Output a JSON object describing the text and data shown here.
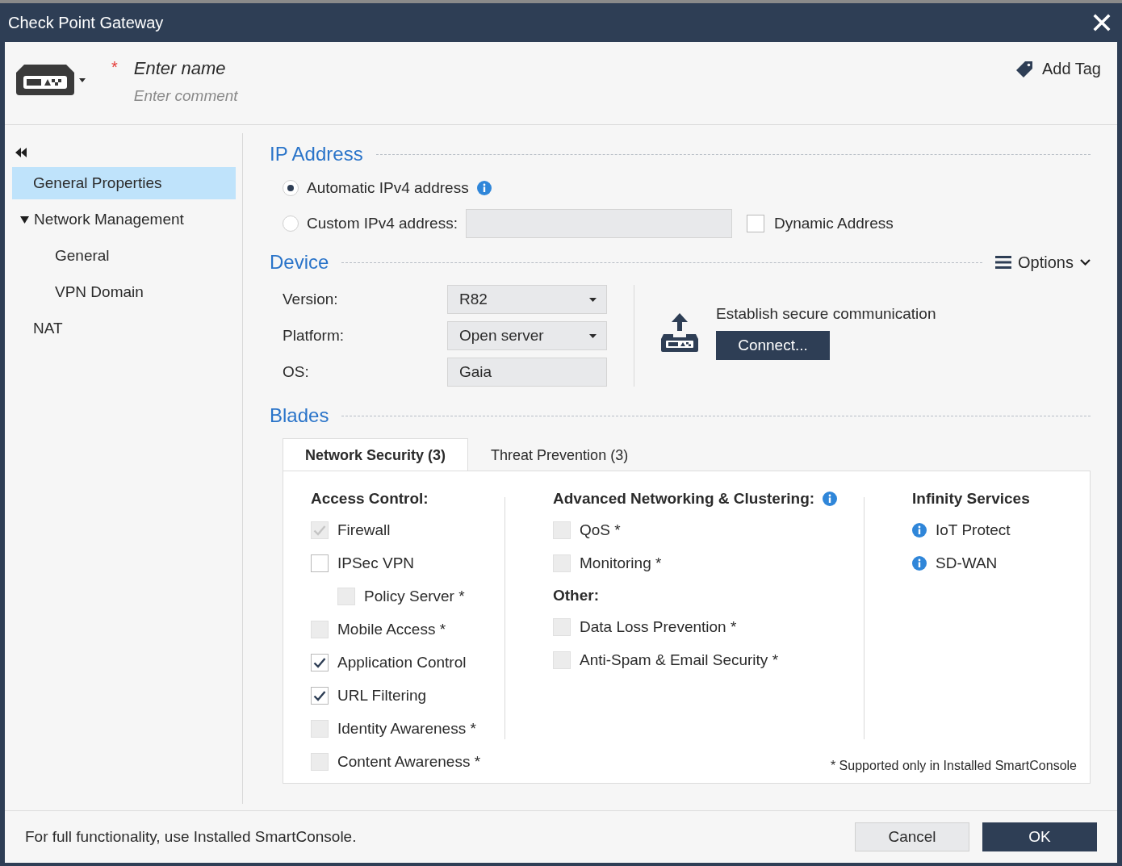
{
  "window": {
    "title": "Check Point Gateway"
  },
  "header": {
    "required_mark": "*",
    "name_placeholder": "Enter name",
    "comment_placeholder": "Enter comment",
    "add_tag": "Add Tag"
  },
  "sidebar": {
    "items": [
      {
        "label": "General Properties",
        "selected": true
      },
      {
        "label": "Network Management",
        "selected": false,
        "expanded": true,
        "children": [
          {
            "label": "General",
            "selected": false
          },
          {
            "label": "VPN Domain",
            "selected": false
          }
        ]
      },
      {
        "label": "NAT",
        "selected": false
      }
    ]
  },
  "ip_address": {
    "title": "IP Address",
    "options": [
      {
        "label": "Automatic IPv4 address",
        "selected": true,
        "info": true
      },
      {
        "label": "Custom IPv4 address:",
        "selected": false,
        "info": false
      }
    ],
    "dynamic_address": {
      "label": "Dynamic Address",
      "checked": false
    }
  },
  "device": {
    "title": "Device",
    "options_label": "Options",
    "fields": [
      {
        "label": "Version:",
        "value": "R82",
        "kind": "dropdown"
      },
      {
        "label": "Platform:",
        "value": "Open server",
        "kind": "dropdown"
      },
      {
        "label": "OS:",
        "value": "Gaia",
        "kind": "readonly"
      }
    ],
    "connect_text": "Establish secure communication",
    "connect_button": "Connect..."
  },
  "blades": {
    "title": "Blades",
    "tabs": [
      {
        "label": "Network Security (3)",
        "selected": true
      },
      {
        "label": "Threat Prevention (3)",
        "selected": false
      }
    ],
    "columns": [
      {
        "groups": [
          {
            "title": "Access Control:",
            "info": false,
            "items": [
              {
                "kind": "checkbox",
                "label": "Firewall",
                "checked": true,
                "disabled": true
              },
              {
                "kind": "checkbox",
                "label": "IPSec VPN",
                "checked": false,
                "disabled": false,
                "children": [
                  {
                    "kind": "checkbox",
                    "label": "Policy Server *",
                    "checked": false,
                    "disabled": true
                  }
                ]
              },
              {
                "kind": "checkbox",
                "label": "Mobile Access *",
                "checked": false,
                "disabled": true
              },
              {
                "kind": "checkbox",
                "label": "Application Control",
                "checked": true,
                "disabled": false
              },
              {
                "kind": "checkbox",
                "label": "URL Filtering",
                "checked": true,
                "disabled": false
              },
              {
                "kind": "checkbox",
                "label": "Identity Awareness *",
                "checked": false,
                "disabled": true
              },
              {
                "kind": "checkbox",
                "label": "Content Awareness *",
                "checked": false,
                "disabled": true
              }
            ]
          }
        ]
      },
      {
        "groups": [
          {
            "title": "Advanced Networking & Clustering:",
            "info": true,
            "items": [
              {
                "kind": "checkbox",
                "label": "QoS *",
                "checked": false,
                "disabled": true
              },
              {
                "kind": "checkbox",
                "label": "Monitoring *",
                "checked": false,
                "disabled": true
              }
            ]
          },
          {
            "title": "Other:",
            "info": false,
            "items": [
              {
                "kind": "checkbox",
                "label": "Data Loss Prevention *",
                "checked": false,
                "disabled": true
              },
              {
                "kind": "checkbox",
                "label": "Anti-Spam & Email Security *",
                "checked": false,
                "disabled": true
              }
            ]
          }
        ]
      },
      {
        "groups": [
          {
            "title": "Infinity Services",
            "info": false,
            "items": [
              {
                "kind": "info",
                "label": "IoT Protect"
              },
              {
                "kind": "info",
                "label": "SD-WAN"
              }
            ]
          }
        ]
      }
    ],
    "footnote": "* Supported only in Installed SmartConsole"
  },
  "footer": {
    "message": "For full functionality, use Installed SmartConsole.",
    "buttons": [
      {
        "label": "Cancel",
        "kind": "secondary"
      },
      {
        "label": "OK",
        "kind": "primary"
      }
    ]
  }
}
